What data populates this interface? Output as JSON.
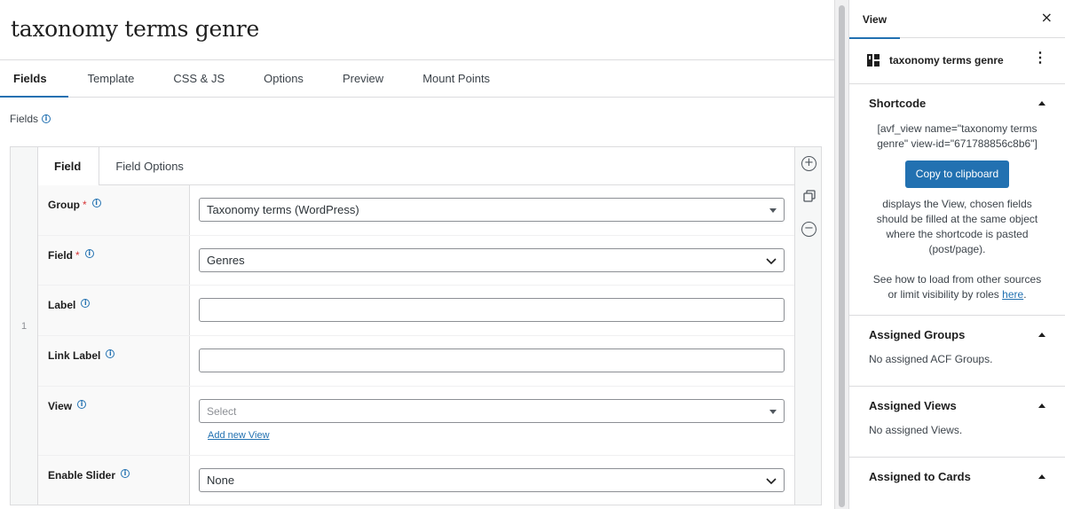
{
  "page": {
    "title": "taxonomy terms genre"
  },
  "tabs": [
    "Fields",
    "Template",
    "CSS & JS",
    "Options",
    "Preview",
    "Mount Points"
  ],
  "section_label": "Fields",
  "repeater": {
    "row_number": "1",
    "inner_tabs": [
      "Field",
      "Field Options"
    ],
    "rows": {
      "group": {
        "label": "Group",
        "required_mark": "*",
        "value": "Taxonomy terms (WordPress)"
      },
      "field": {
        "label": "Field",
        "required_mark": "*",
        "value": "Genres"
      },
      "label": {
        "label": "Label",
        "value": ""
      },
      "link_label": {
        "label": "Link Label",
        "value": ""
      },
      "view": {
        "label": "View",
        "placeholder": "Select",
        "add_link": "Add new View"
      },
      "slider": {
        "label": "Enable Slider",
        "value": "None"
      }
    }
  },
  "sidebar": {
    "tab": "View",
    "close_icon": "×",
    "card_title": "taxonomy terms genre",
    "kebab_icon": "⋮",
    "shortcode": {
      "title": "Shortcode",
      "line1": "[avf_view name=\"taxonomy terms",
      "line2": "genre\" view-id=\"671788856c8b6\"]",
      "button": "Copy to clipboard",
      "desc1": "displays the View, chosen fields",
      "desc2": "should be filled at the same object",
      "desc3": "where the shortcode is pasted",
      "desc4": "(post/page).",
      "see1": "See how to load from other sources",
      "see2": "or limit visibility by roles ",
      "see_link": "here",
      "see_end": "."
    },
    "assigned_groups": {
      "title": "Assigned Groups",
      "text": "No assigned ACF Groups."
    },
    "assigned_views": {
      "title": "Assigned Views",
      "text": "No assigned Views."
    },
    "assigned_cards": {
      "title": "Assigned to Cards"
    }
  },
  "colors": {
    "accent": "#2271b1",
    "required": "#d63638"
  }
}
